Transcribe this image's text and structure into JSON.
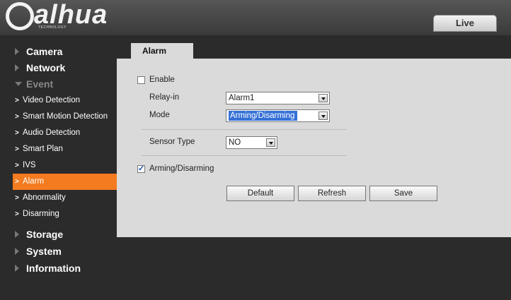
{
  "header": {
    "logo_text": "alhua",
    "logo_sub": "TECHNOLOGY",
    "live_tab": "Live"
  },
  "sidebar": {
    "items": [
      {
        "label": "Camera"
      },
      {
        "label": "Network"
      },
      {
        "label": "Event"
      },
      {
        "label": "Storage"
      },
      {
        "label": "System"
      },
      {
        "label": "Information"
      }
    ],
    "event_sub": [
      {
        "label": "Video Detection"
      },
      {
        "label": "Smart Motion Detection"
      },
      {
        "label": "Audio Detection"
      },
      {
        "label": "Smart Plan"
      },
      {
        "label": "IVS"
      },
      {
        "label": "Alarm"
      },
      {
        "label": "Abnormality"
      },
      {
        "label": "Disarming"
      }
    ],
    "active_sub": "Alarm"
  },
  "tab": {
    "label": "Alarm"
  },
  "form": {
    "enable": {
      "label": "Enable",
      "checked": false
    },
    "relay_in": {
      "label": "Relay-in",
      "value": "Alarm1"
    },
    "mode": {
      "label": "Mode",
      "value": "Arming/Disarming"
    },
    "sensor_type": {
      "label": "Sensor Type",
      "value": "NO"
    },
    "arming": {
      "label": "Arming/Disarming",
      "checked": true
    }
  },
  "buttons": {
    "default": "Default",
    "refresh": "Refresh",
    "save": "Save"
  },
  "colors": {
    "accent": "#f47b20",
    "panel": "#dadada",
    "background": "#2b2b2b",
    "selection": "#3470d6"
  }
}
